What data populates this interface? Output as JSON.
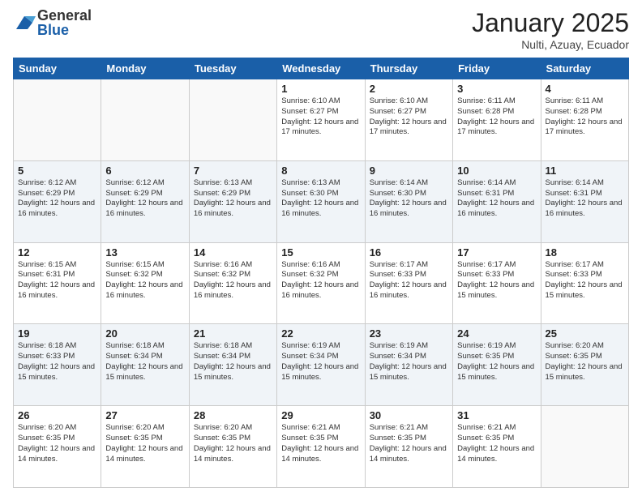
{
  "logo": {
    "general": "General",
    "blue": "Blue"
  },
  "header": {
    "month": "January 2025",
    "location": "Nulti, Azuay, Ecuador"
  },
  "days_of_week": [
    "Sunday",
    "Monday",
    "Tuesday",
    "Wednesday",
    "Thursday",
    "Friday",
    "Saturday"
  ],
  "weeks": [
    [
      {
        "day": "",
        "info": ""
      },
      {
        "day": "",
        "info": ""
      },
      {
        "day": "",
        "info": ""
      },
      {
        "day": "1",
        "info": "Sunrise: 6:10 AM\nSunset: 6:27 PM\nDaylight: 12 hours and 17 minutes."
      },
      {
        "day": "2",
        "info": "Sunrise: 6:10 AM\nSunset: 6:27 PM\nDaylight: 12 hours and 17 minutes."
      },
      {
        "day": "3",
        "info": "Sunrise: 6:11 AM\nSunset: 6:28 PM\nDaylight: 12 hours and 17 minutes."
      },
      {
        "day": "4",
        "info": "Sunrise: 6:11 AM\nSunset: 6:28 PM\nDaylight: 12 hours and 17 minutes."
      }
    ],
    [
      {
        "day": "5",
        "info": "Sunrise: 6:12 AM\nSunset: 6:29 PM\nDaylight: 12 hours and 16 minutes."
      },
      {
        "day": "6",
        "info": "Sunrise: 6:12 AM\nSunset: 6:29 PM\nDaylight: 12 hours and 16 minutes."
      },
      {
        "day": "7",
        "info": "Sunrise: 6:13 AM\nSunset: 6:29 PM\nDaylight: 12 hours and 16 minutes."
      },
      {
        "day": "8",
        "info": "Sunrise: 6:13 AM\nSunset: 6:30 PM\nDaylight: 12 hours and 16 minutes."
      },
      {
        "day": "9",
        "info": "Sunrise: 6:14 AM\nSunset: 6:30 PM\nDaylight: 12 hours and 16 minutes."
      },
      {
        "day": "10",
        "info": "Sunrise: 6:14 AM\nSunset: 6:31 PM\nDaylight: 12 hours and 16 minutes."
      },
      {
        "day": "11",
        "info": "Sunrise: 6:14 AM\nSunset: 6:31 PM\nDaylight: 12 hours and 16 minutes."
      }
    ],
    [
      {
        "day": "12",
        "info": "Sunrise: 6:15 AM\nSunset: 6:31 PM\nDaylight: 12 hours and 16 minutes."
      },
      {
        "day": "13",
        "info": "Sunrise: 6:15 AM\nSunset: 6:32 PM\nDaylight: 12 hours and 16 minutes."
      },
      {
        "day": "14",
        "info": "Sunrise: 6:16 AM\nSunset: 6:32 PM\nDaylight: 12 hours and 16 minutes."
      },
      {
        "day": "15",
        "info": "Sunrise: 6:16 AM\nSunset: 6:32 PM\nDaylight: 12 hours and 16 minutes."
      },
      {
        "day": "16",
        "info": "Sunrise: 6:17 AM\nSunset: 6:33 PM\nDaylight: 12 hours and 16 minutes."
      },
      {
        "day": "17",
        "info": "Sunrise: 6:17 AM\nSunset: 6:33 PM\nDaylight: 12 hours and 15 minutes."
      },
      {
        "day": "18",
        "info": "Sunrise: 6:17 AM\nSunset: 6:33 PM\nDaylight: 12 hours and 15 minutes."
      }
    ],
    [
      {
        "day": "19",
        "info": "Sunrise: 6:18 AM\nSunset: 6:33 PM\nDaylight: 12 hours and 15 minutes."
      },
      {
        "day": "20",
        "info": "Sunrise: 6:18 AM\nSunset: 6:34 PM\nDaylight: 12 hours and 15 minutes."
      },
      {
        "day": "21",
        "info": "Sunrise: 6:18 AM\nSunset: 6:34 PM\nDaylight: 12 hours and 15 minutes."
      },
      {
        "day": "22",
        "info": "Sunrise: 6:19 AM\nSunset: 6:34 PM\nDaylight: 12 hours and 15 minutes."
      },
      {
        "day": "23",
        "info": "Sunrise: 6:19 AM\nSunset: 6:34 PM\nDaylight: 12 hours and 15 minutes."
      },
      {
        "day": "24",
        "info": "Sunrise: 6:19 AM\nSunset: 6:35 PM\nDaylight: 12 hours and 15 minutes."
      },
      {
        "day": "25",
        "info": "Sunrise: 6:20 AM\nSunset: 6:35 PM\nDaylight: 12 hours and 15 minutes."
      }
    ],
    [
      {
        "day": "26",
        "info": "Sunrise: 6:20 AM\nSunset: 6:35 PM\nDaylight: 12 hours and 14 minutes."
      },
      {
        "day": "27",
        "info": "Sunrise: 6:20 AM\nSunset: 6:35 PM\nDaylight: 12 hours and 14 minutes."
      },
      {
        "day": "28",
        "info": "Sunrise: 6:20 AM\nSunset: 6:35 PM\nDaylight: 12 hours and 14 minutes."
      },
      {
        "day": "29",
        "info": "Sunrise: 6:21 AM\nSunset: 6:35 PM\nDaylight: 12 hours and 14 minutes."
      },
      {
        "day": "30",
        "info": "Sunrise: 6:21 AM\nSunset: 6:35 PM\nDaylight: 12 hours and 14 minutes."
      },
      {
        "day": "31",
        "info": "Sunrise: 6:21 AM\nSunset: 6:35 PM\nDaylight: 12 hours and 14 minutes."
      },
      {
        "day": "",
        "info": ""
      }
    ]
  ]
}
